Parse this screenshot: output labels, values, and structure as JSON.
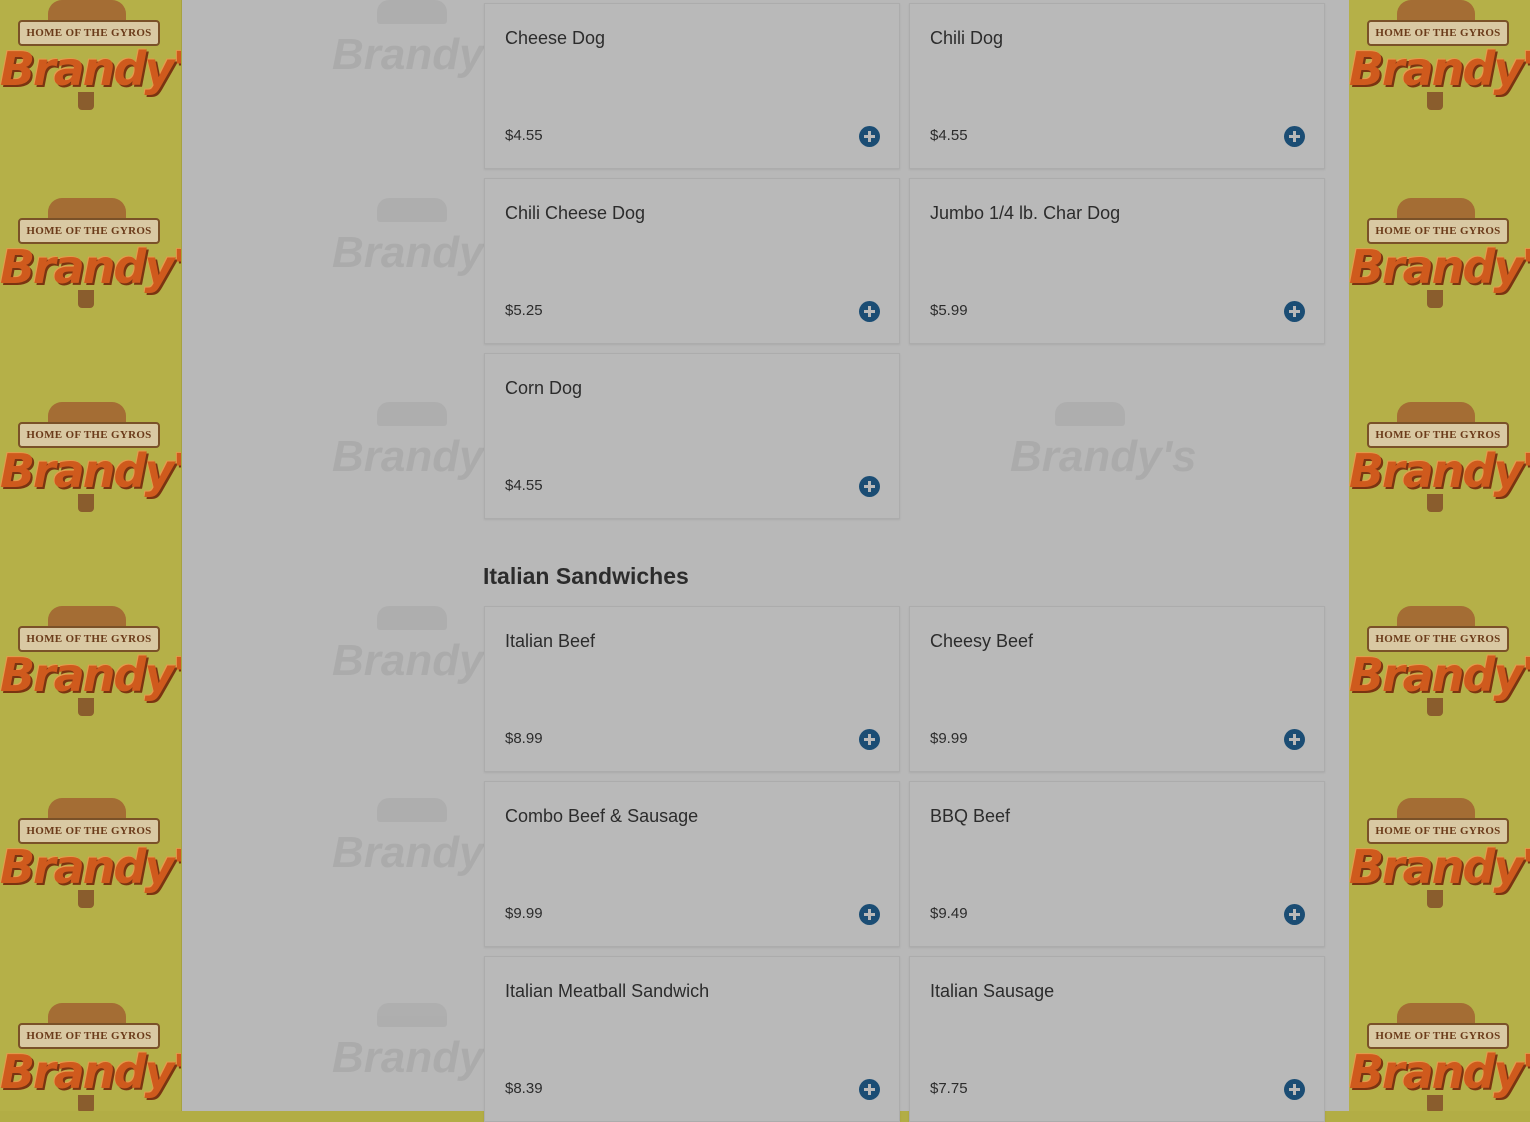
{
  "brand": {
    "tagline": "HOME OF THE GYROS",
    "name": "Brandy's"
  },
  "icons": {
    "add": "plus-circle-icon"
  },
  "colors": {
    "side_panel": "#b5b048",
    "content_bg": "#b8b8b8",
    "add_button": "#1b4d74",
    "logo_orange": "#cf5a1d"
  },
  "menu": {
    "hot_dogs": {
      "items": [
        {
          "name": "Cheese Dog",
          "price": "$4.55"
        },
        {
          "name": "Chili Dog",
          "price": "$4.55"
        },
        {
          "name": "Chili Cheese Dog",
          "price": "$5.25"
        },
        {
          "name": "Jumbo 1/4 lb. Char Dog",
          "price": "$5.99"
        },
        {
          "name": "Corn Dog",
          "price": "$4.55"
        }
      ]
    },
    "italian_sandwiches": {
      "title": "Italian Sandwiches",
      "items": [
        {
          "name": "Italian Beef",
          "price": "$8.99"
        },
        {
          "name": "Cheesy Beef",
          "price": "$9.99"
        },
        {
          "name": "Combo Beef & Sausage",
          "price": "$9.99"
        },
        {
          "name": "BBQ Beef",
          "price": "$9.49"
        },
        {
          "name": "Italian Meatball Sandwich",
          "price": "$8.39"
        },
        {
          "name": "Italian Sausage",
          "price": "$7.75"
        }
      ]
    }
  }
}
